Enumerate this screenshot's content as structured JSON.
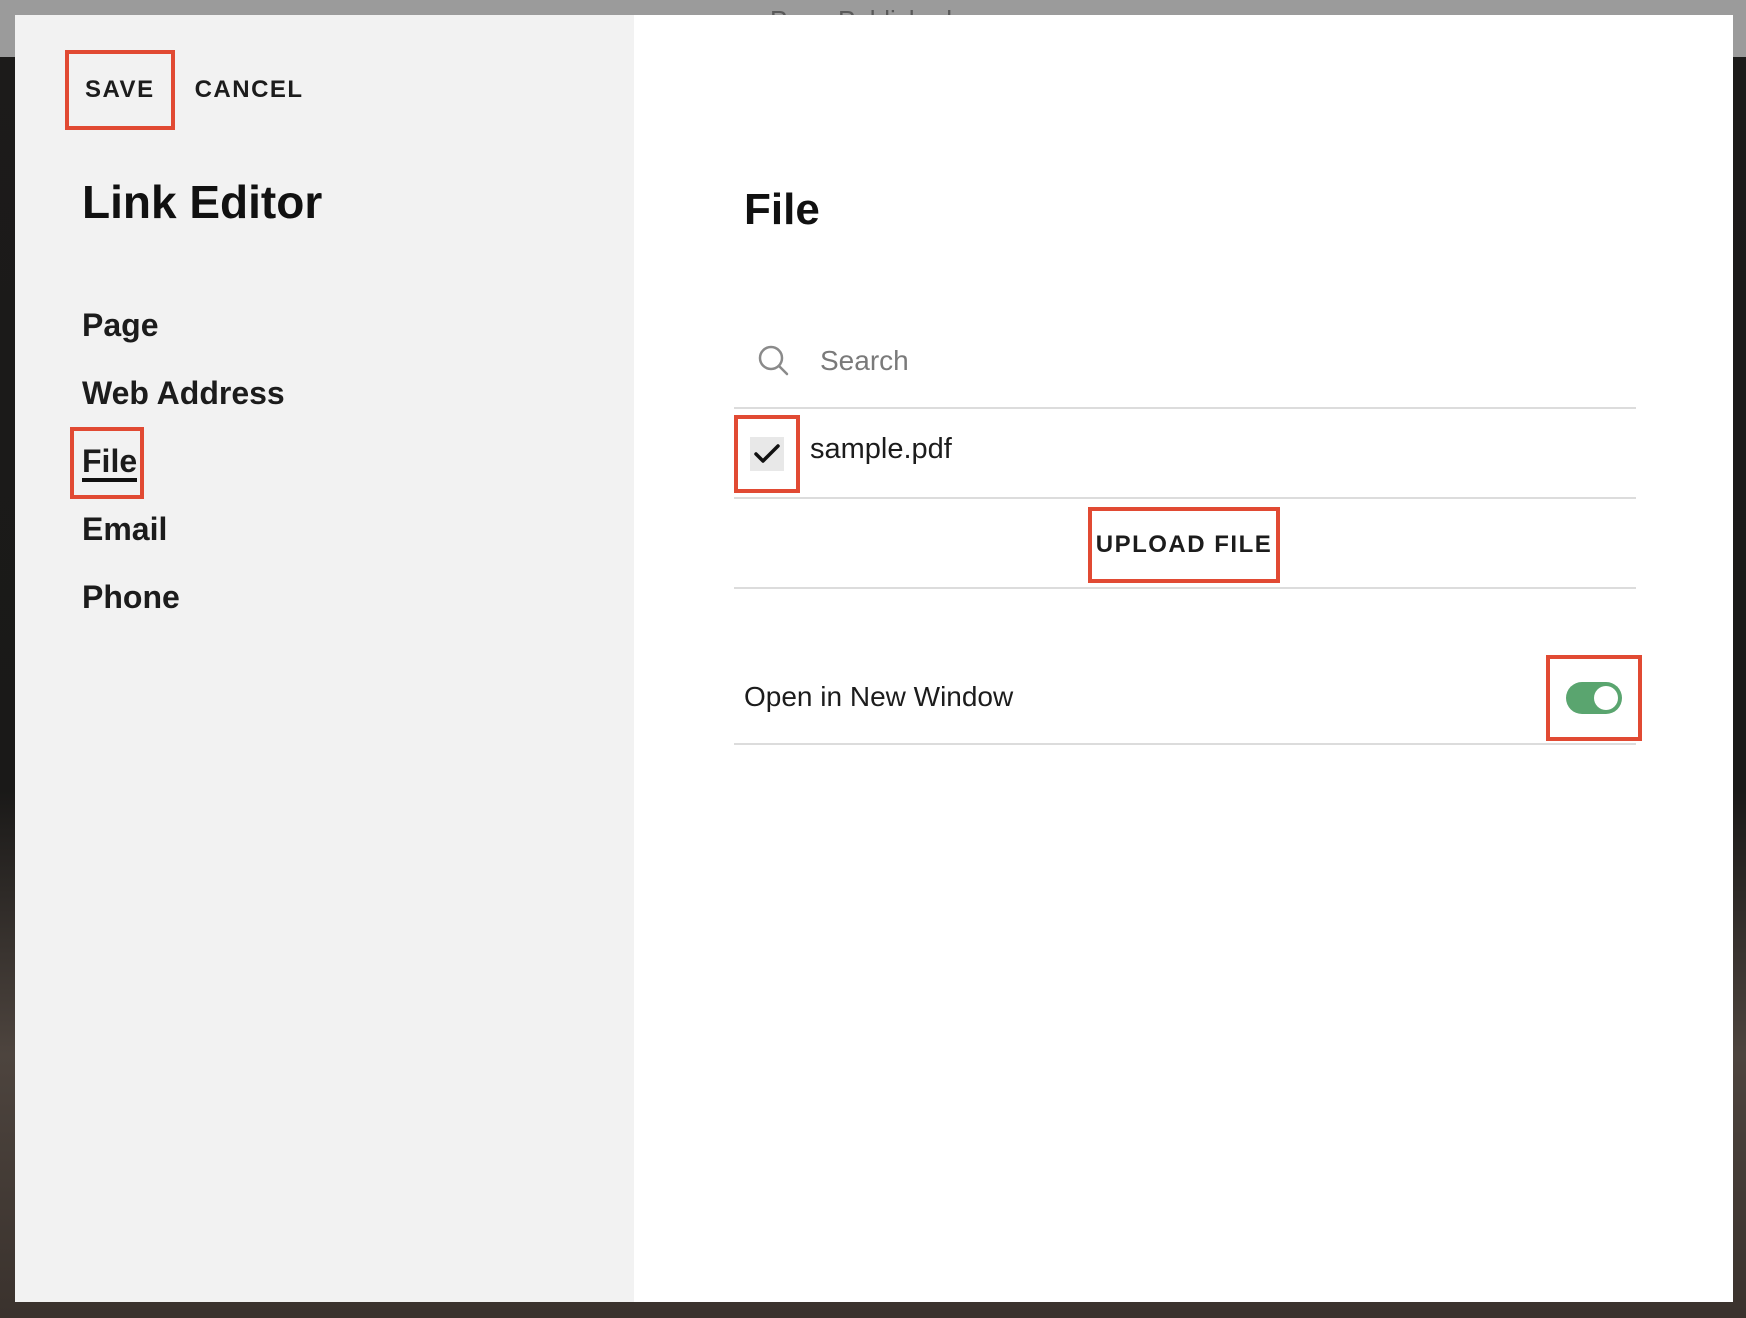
{
  "header": {
    "background_text": "Page Published"
  },
  "sidebar": {
    "save_label": "SAVE",
    "cancel_label": "CANCEL",
    "title": "Link Editor",
    "items": [
      {
        "label": "Page",
        "active": false
      },
      {
        "label": "Web Address",
        "active": false
      },
      {
        "label": "File",
        "active": true
      },
      {
        "label": "Email",
        "active": false
      },
      {
        "label": "Phone",
        "active": false
      }
    ]
  },
  "main": {
    "title": "File",
    "search": {
      "placeholder": "Search",
      "icon": "search-icon"
    },
    "files": [
      {
        "name": "sample.pdf",
        "checked": true
      }
    ],
    "upload_label": "UPLOAD FILE",
    "open_new_window": {
      "label": "Open in New Window",
      "enabled": true
    }
  },
  "colors": {
    "highlight": "#e14a33",
    "toggle_on": "#5aa56f",
    "sidebar_bg": "#f2f2f2"
  }
}
